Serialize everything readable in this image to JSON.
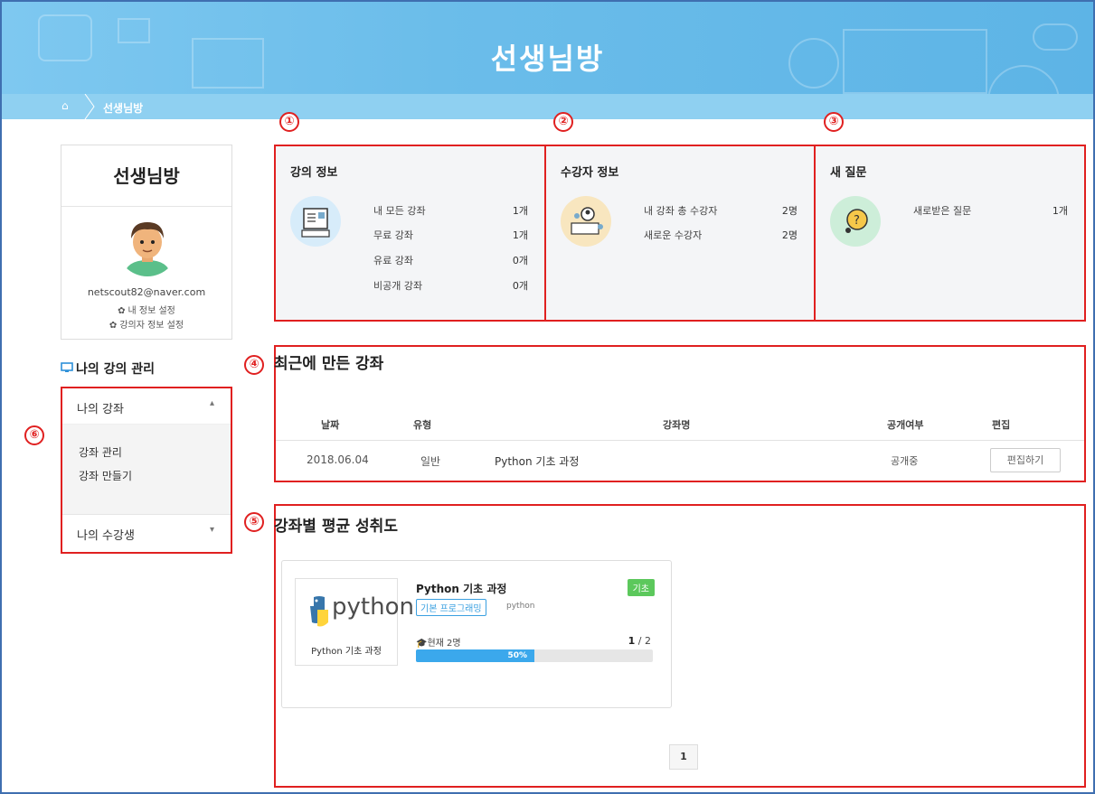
{
  "banner": {
    "title": "선생님방"
  },
  "breadcrumb": {
    "current": "선생님방"
  },
  "profile": {
    "name": "선생님방",
    "email": "netscout82@naver.com",
    "link_my_info": "내 정보 설정",
    "link_instructor_info": "강의자 정보 설정"
  },
  "sidebar": {
    "section_title": "나의 강의 관리",
    "menu_my_courses": "나의 강좌",
    "sub_manage": "강좌 관리",
    "sub_create": "강좌 만들기",
    "menu_my_students": "나의 수강생"
  },
  "markers": [
    "①",
    "②",
    "③",
    "④",
    "⑤",
    "⑥"
  ],
  "lecture_info": {
    "title": "강의 정보",
    "rows": [
      {
        "label": "내 모든 강좌",
        "value": "1개"
      },
      {
        "label": "무료 강좌",
        "value": "1개"
      },
      {
        "label": "유료 강좌",
        "value": "0개"
      },
      {
        "label": "비공개 강좌",
        "value": "0개"
      }
    ]
  },
  "student_info": {
    "title": "수강자 정보",
    "rows": [
      {
        "label": "내 강좌 총 수강자",
        "value": "2명"
      },
      {
        "label": "새로운 수강자",
        "value": "2명"
      }
    ]
  },
  "new_questions": {
    "title": "새 질문",
    "rows": [
      {
        "label": "새로받은 질문",
        "value": "1개"
      }
    ]
  },
  "recent": {
    "title": "최근에 만든 강좌",
    "headers": [
      "날짜",
      "유형",
      "강좌명",
      "공개여부",
      "편집"
    ],
    "row": {
      "date": "2018.06.04",
      "type": "일반",
      "name": "Python 기초 과정",
      "status": "공개중",
      "edit": "편집하기"
    }
  },
  "achievement": {
    "title": "강좌별 평균 성취도",
    "course": {
      "logo_text": "python",
      "thumb_caption": "Python 기초 과정",
      "title": "Python 기초 과정",
      "level": "기초",
      "tag": "기본 프로그래밍",
      "tag2": "python",
      "students": "현재 2명",
      "ratio_done": "1",
      "ratio_total": "/ 2",
      "progress_label": "50%",
      "progress": 0.5
    },
    "page": "1"
  },
  "colors": {
    "accent": "#3ba8ec",
    "marker": "#e02020",
    "badge": "#5cc85c"
  }
}
